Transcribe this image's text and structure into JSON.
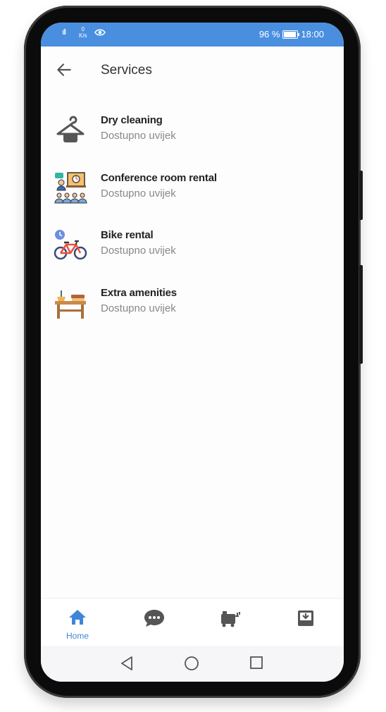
{
  "status_bar": {
    "signal": "ıll",
    "speed_value": "0",
    "speed_unit": "K/s",
    "battery_percent": "96 %",
    "time": "18:00"
  },
  "header": {
    "title": "Services"
  },
  "services": [
    {
      "name": "Dry cleaning",
      "availability": "Dostupno uvijek",
      "icon": "hanger-icon"
    },
    {
      "name": "Conference room rental",
      "availability": "Dostupno uvijek",
      "icon": "conference-icon"
    },
    {
      "name": "Bike rental",
      "availability": "Dostupno uvijek",
      "icon": "bike-icon"
    },
    {
      "name": "Extra amenities",
      "availability": "Dostupno uvijek",
      "icon": "amenities-table-icon"
    }
  ],
  "bottom_nav": {
    "items": [
      {
        "label": "Home",
        "icon": "home-icon",
        "active": true
      },
      {
        "label": "",
        "icon": "chat-icon",
        "active": false
      },
      {
        "label": "",
        "icon": "room-service-cart-icon",
        "active": false
      },
      {
        "label": "",
        "icon": "inbox-download-icon",
        "active": false
      }
    ]
  },
  "colors": {
    "status_bar": "#4a8fdf",
    "accent": "#3f86d9",
    "icon_gray": "#555555",
    "text_primary": "#222222",
    "text_secondary": "#888888"
  }
}
